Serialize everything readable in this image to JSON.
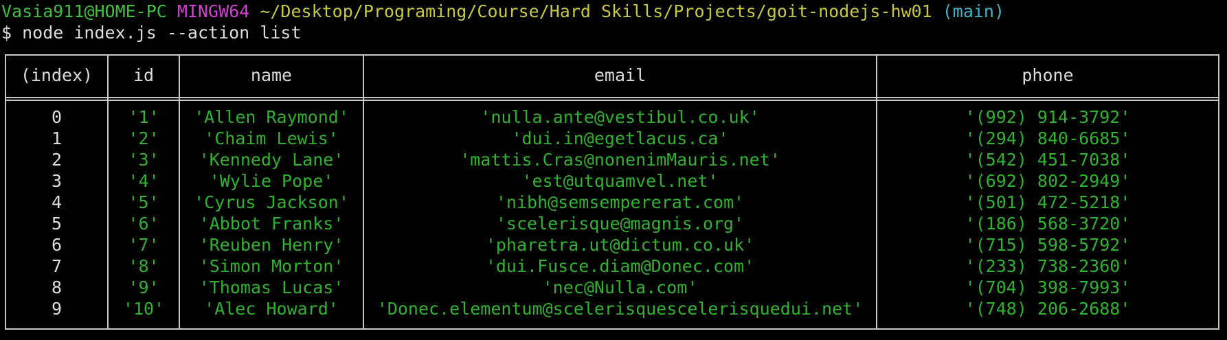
{
  "terminal": {
    "prompt": {
      "user_host": "Vasia911@HOME-PC",
      "shell": "MINGW64",
      "path": "~/Desktop/Programing/Course/Hard Skills/Projects/goit-nodejs-hw01",
      "branch": "(main)"
    },
    "command": "$ node index.js --action list",
    "colors": {
      "user": "#3fc13f",
      "shell": "#d43fd4",
      "path": "#c9c93c",
      "branch": "#3cb6c6",
      "values": "#2fb32f",
      "text": "#dcdcdc",
      "border": "#c8c8c8"
    }
  },
  "table": {
    "headers": {
      "index": "(index)",
      "id": "id",
      "name": "name",
      "email": "email",
      "phone": "phone"
    },
    "rows": [
      {
        "index": "0",
        "id": "'1'",
        "name": "'Allen Raymond'",
        "email": "'nulla.ante@vestibul.co.uk'",
        "phone": "'(992) 914-3792'"
      },
      {
        "index": "1",
        "id": "'2'",
        "name": "'Chaim Lewis'",
        "email": "'dui.in@egetlacus.ca'",
        "phone": "'(294) 840-6685'"
      },
      {
        "index": "2",
        "id": "'3'",
        "name": "'Kennedy Lane'",
        "email": "'mattis.Cras@nonenimMauris.net'",
        "phone": "'(542) 451-7038'"
      },
      {
        "index": "3",
        "id": "'4'",
        "name": "'Wylie Pope'",
        "email": "'est@utquamvel.net'",
        "phone": "'(692) 802-2949'"
      },
      {
        "index": "4",
        "id": "'5'",
        "name": "'Cyrus Jackson'",
        "email": "'nibh@semsempererat.com'",
        "phone": "'(501) 472-5218'"
      },
      {
        "index": "5",
        "id": "'6'",
        "name": "'Abbot Franks'",
        "email": "'scelerisque@magnis.org'",
        "phone": "'(186) 568-3720'"
      },
      {
        "index": "6",
        "id": "'7'",
        "name": "'Reuben Henry'",
        "email": "'pharetra.ut@dictum.co.uk'",
        "phone": "'(715) 598-5792'"
      },
      {
        "index": "7",
        "id": "'8'",
        "name": "'Simon Morton'",
        "email": "'dui.Fusce.diam@Donec.com'",
        "phone": "'(233) 738-2360'"
      },
      {
        "index": "8",
        "id": "'9'",
        "name": "'Thomas Lucas'",
        "email": "'nec@Nulla.com'",
        "phone": "'(704) 398-7993'"
      },
      {
        "index": "9",
        "id": "'10'",
        "name": "'Alec Howard'",
        "email": "'Donec.elementum@scelerisquescelerisquedui.net'",
        "phone": "'(748) 206-2688'"
      }
    ]
  }
}
